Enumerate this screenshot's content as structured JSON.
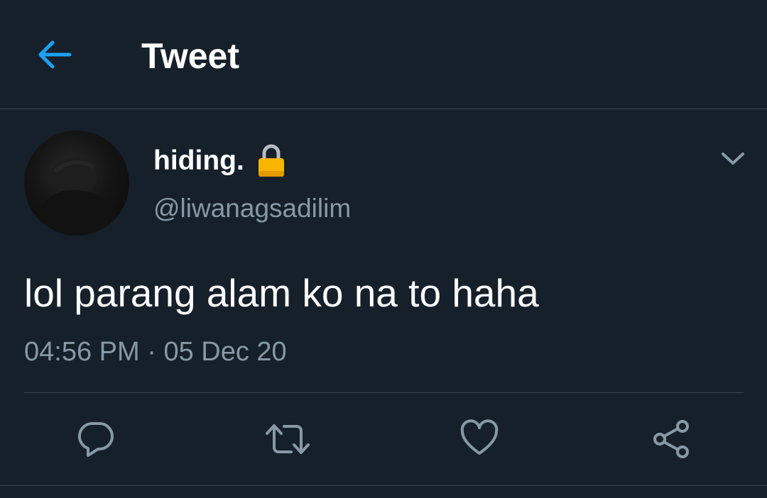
{
  "colors": {
    "background": "#15202b",
    "accent": "#1da1f2",
    "secondary_text": "#8899a6",
    "divider": "#38444d",
    "lock": "#f7b500"
  },
  "header": {
    "title": "Tweet",
    "back_icon": "arrow-left-icon"
  },
  "author": {
    "display_name": "hiding.",
    "protected_icon": "lock-icon",
    "username": "@liwanagsadilim",
    "menu_icon": "chevron-down-icon"
  },
  "tweet": {
    "text": "lol parang alam ko na to haha",
    "time": "04:56 PM",
    "separator": "·",
    "date": "05 Dec 20"
  },
  "actions": [
    {
      "name": "reply",
      "icon": "reply-icon"
    },
    {
      "name": "retweet",
      "icon": "retweet-icon"
    },
    {
      "name": "like",
      "icon": "heart-icon"
    },
    {
      "name": "share",
      "icon": "share-icon"
    }
  ]
}
